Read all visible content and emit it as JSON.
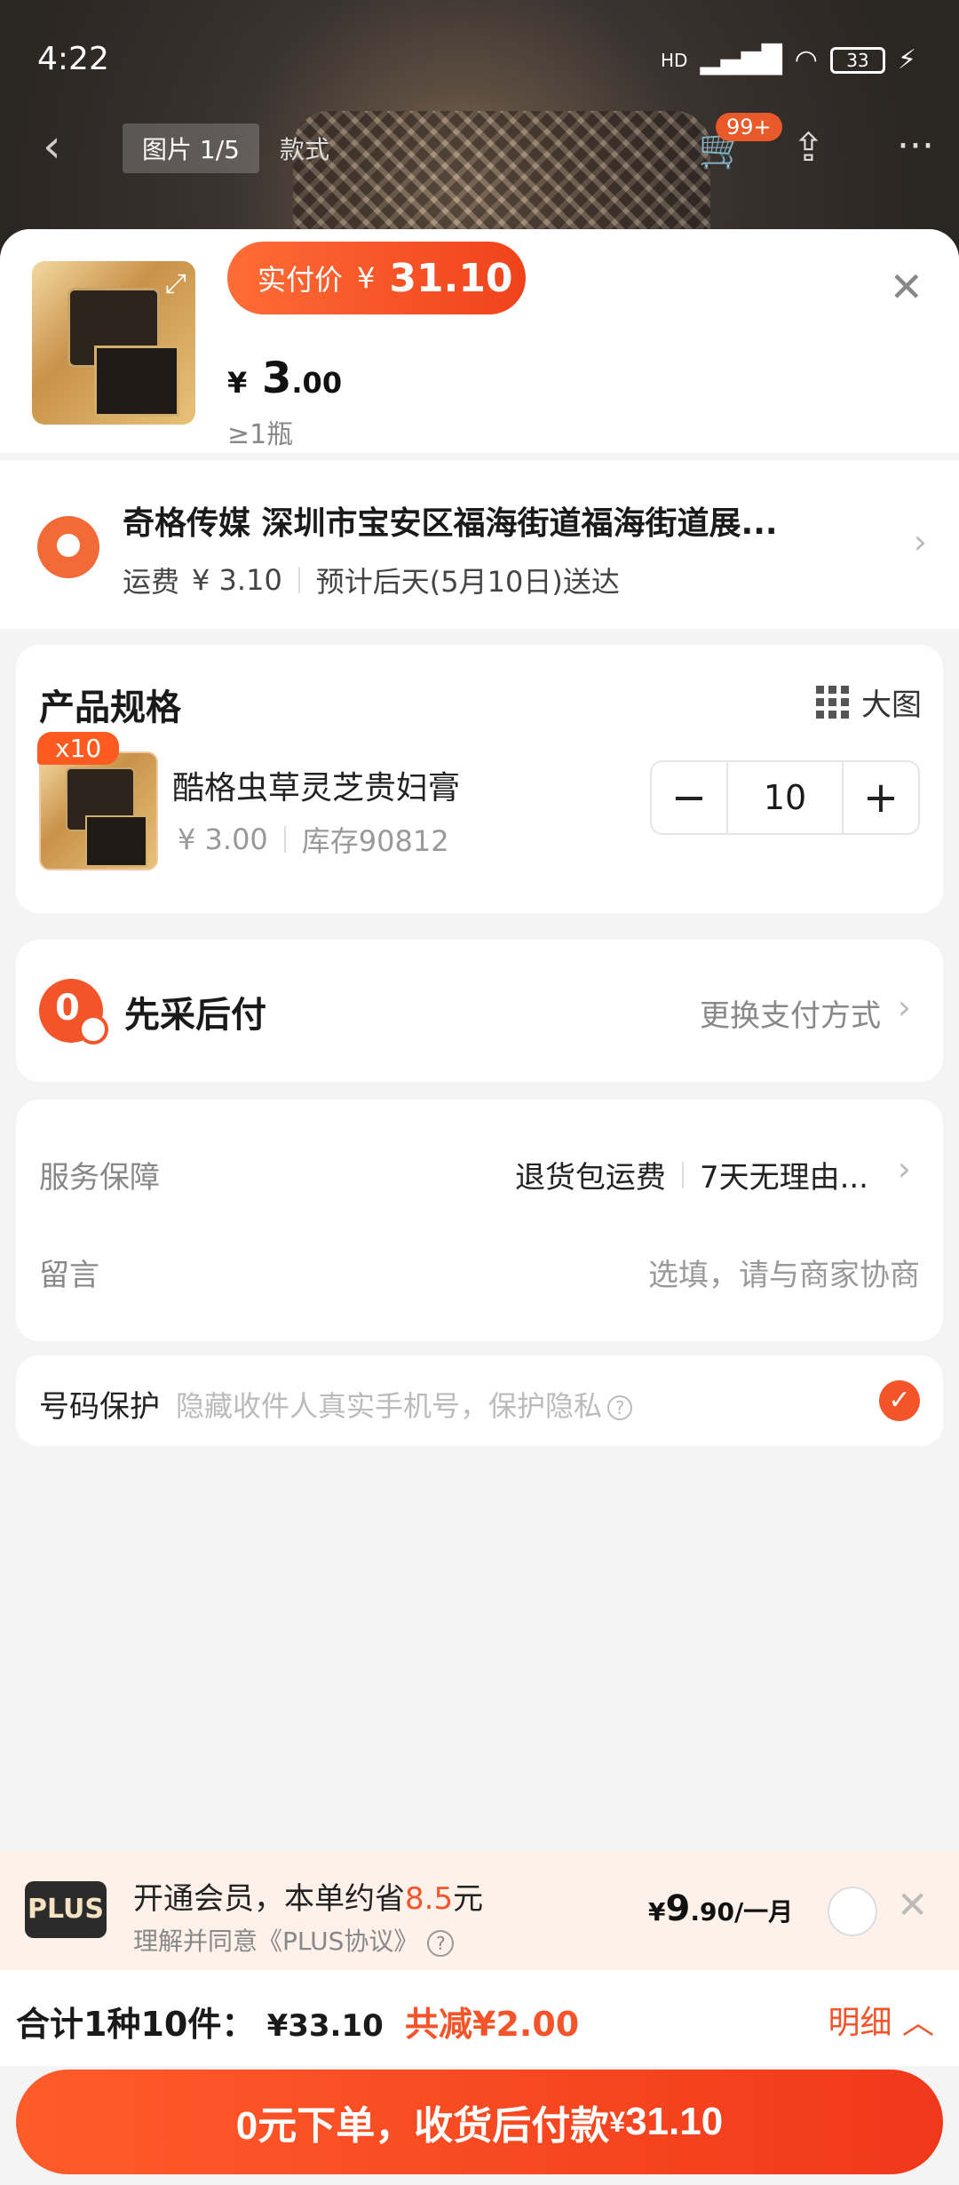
{
  "status_bar": {
    "time": "4:22",
    "network": "HD",
    "battery": "33"
  },
  "nav": {
    "pic_tab": "图片 1/5",
    "style_tab": "款式",
    "cart_badge": "99+"
  },
  "header": {
    "pay_label": "实付价",
    "pay_currency": "¥",
    "pay_price": "31.10",
    "unit_currency": "¥",
    "unit_price_int": "3",
    "unit_price_dec": ".00",
    "min_qty": "≥1瓶"
  },
  "address": {
    "line1": "奇格传媒 深圳市宝安区福海街道福海街道展...",
    "shipping_label": "运费",
    "shipping_fee": "¥ 3.10",
    "delivery": "预计后天(5月10日)送达"
  },
  "spec": {
    "title": "产品规格",
    "big_view": "大图",
    "qty_badge": "x10",
    "product_name": "酷格虫草灵芝贵妇膏",
    "product_price": "¥ 3.00",
    "stock": "库存90812",
    "quantity": "10"
  },
  "payment": {
    "method": "先采后付",
    "change": "更换支付方式",
    "icon_text": "0"
  },
  "service": {
    "label": "服务保障",
    "item1": "退货包运费",
    "item2": "7天无理由...",
    "message_label": "留言",
    "message_placeholder": "选填，请与商家协商"
  },
  "phone_protect": {
    "label": "号码保护",
    "desc": "隐藏收件人真实手机号，保护隐私"
  },
  "plus": {
    "logo": "PLUS",
    "text_pre": "开通会员，本单约省",
    "saving": "8.5",
    "text_post": "元",
    "agreement": "理解并同意《PLUS协议》",
    "price_cur": "¥",
    "price_int": "9",
    "price_dec": ".90",
    "period": "/一月"
  },
  "total": {
    "label": "合计1种10件：",
    "amount": "¥33.10",
    "discount": "共减¥2.00",
    "detail": "明细"
  },
  "submit": {
    "text": "0元下单，收货后付款",
    "currency": "¥",
    "amount": "31.10"
  },
  "colors": {
    "accent": "#f4542a",
    "brand_gradient_start": "#ff6c35"
  }
}
